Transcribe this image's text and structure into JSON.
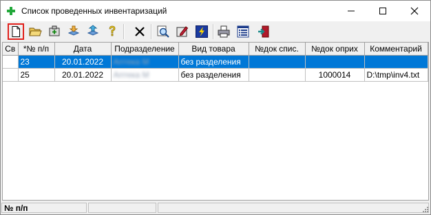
{
  "window": {
    "title": "Список проведенных инвентаризаций",
    "app_icon": "green-cross-icon",
    "controls": [
      "minimize-icon",
      "maximize-icon",
      "close-icon"
    ]
  },
  "toolbar": {
    "buttons": [
      {
        "name": "new-document",
        "icon": "blank-page-icon",
        "active": true
      },
      {
        "name": "open",
        "icon": "open-folder-icon"
      },
      {
        "name": "add",
        "icon": "add-box-icon"
      },
      {
        "name": "import",
        "icon": "import-icon"
      },
      {
        "name": "export",
        "icon": "export-icon"
      },
      {
        "name": "help",
        "icon": "question-icon"
      },
      {
        "name": "delete",
        "icon": "delete-x-icon"
      },
      {
        "name": "search",
        "icon": "magnifier-icon"
      },
      {
        "name": "edit",
        "icon": "edit-icon"
      },
      {
        "name": "run",
        "icon": "lightning-icon"
      },
      {
        "name": "print",
        "icon": "printer-icon"
      },
      {
        "name": "list",
        "icon": "list-icon"
      },
      {
        "name": "exit",
        "icon": "exit-door-icon"
      }
    ]
  },
  "grid": {
    "columns": [
      "Св",
      "*№ п/п",
      "Дата",
      "Подразделение",
      "Вид товара",
      "№док спис.",
      "№док оприх",
      "Комментарий"
    ],
    "rows": [
      {
        "sv": "",
        "num": "23",
        "date": "20.01.2022",
        "dept": "Аптека М",
        "goods": "без разделения",
        "writeoff": "",
        "receipt": "",
        "comment": "",
        "selected": true
      },
      {
        "sv": "",
        "num": "25",
        "date": "20.01.2022",
        "dept": "Аптека М",
        "goods": "без разделения",
        "writeoff": "",
        "receipt": "1000014",
        "comment": "D:\\tmp\\inv4.txt",
        "selected": false
      }
    ]
  },
  "statusbar": {
    "panel1": "№ п/п",
    "panel2": "",
    "panel3": ""
  }
}
